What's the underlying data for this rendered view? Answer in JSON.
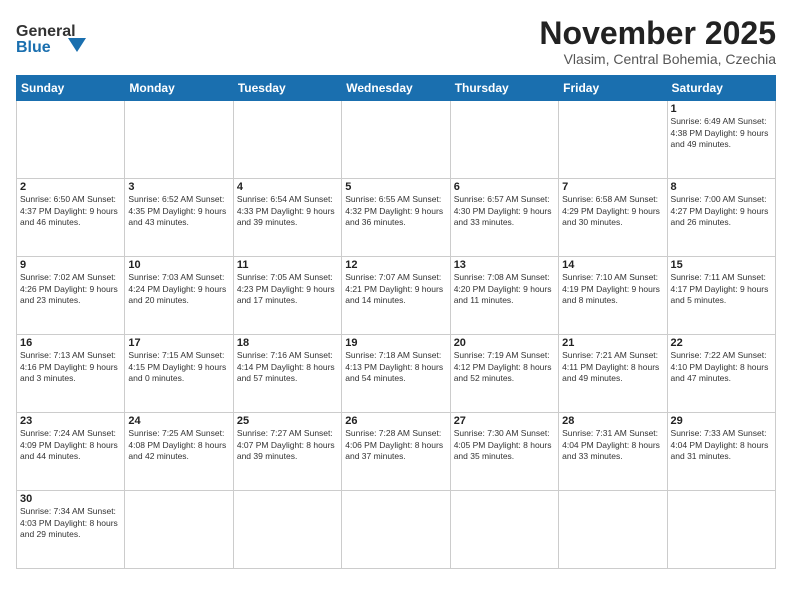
{
  "header": {
    "logo_general": "General",
    "logo_blue": "Blue",
    "month_title": "November 2025",
    "location": "Vlasim, Central Bohemia, Czechia"
  },
  "weekdays": [
    "Sunday",
    "Monday",
    "Tuesday",
    "Wednesday",
    "Thursday",
    "Friday",
    "Saturday"
  ],
  "weeks": [
    [
      {
        "day": "",
        "info": ""
      },
      {
        "day": "",
        "info": ""
      },
      {
        "day": "",
        "info": ""
      },
      {
        "day": "",
        "info": ""
      },
      {
        "day": "",
        "info": ""
      },
      {
        "day": "",
        "info": ""
      },
      {
        "day": "1",
        "info": "Sunrise: 6:49 AM\nSunset: 4:38 PM\nDaylight: 9 hours\nand 49 minutes."
      }
    ],
    [
      {
        "day": "2",
        "info": "Sunrise: 6:50 AM\nSunset: 4:37 PM\nDaylight: 9 hours\nand 46 minutes."
      },
      {
        "day": "3",
        "info": "Sunrise: 6:52 AM\nSunset: 4:35 PM\nDaylight: 9 hours\nand 43 minutes."
      },
      {
        "day": "4",
        "info": "Sunrise: 6:54 AM\nSunset: 4:33 PM\nDaylight: 9 hours\nand 39 minutes."
      },
      {
        "day": "5",
        "info": "Sunrise: 6:55 AM\nSunset: 4:32 PM\nDaylight: 9 hours\nand 36 minutes."
      },
      {
        "day": "6",
        "info": "Sunrise: 6:57 AM\nSunset: 4:30 PM\nDaylight: 9 hours\nand 33 minutes."
      },
      {
        "day": "7",
        "info": "Sunrise: 6:58 AM\nSunset: 4:29 PM\nDaylight: 9 hours\nand 30 minutes."
      },
      {
        "day": "8",
        "info": "Sunrise: 7:00 AM\nSunset: 4:27 PM\nDaylight: 9 hours\nand 26 minutes."
      }
    ],
    [
      {
        "day": "9",
        "info": "Sunrise: 7:02 AM\nSunset: 4:26 PM\nDaylight: 9 hours\nand 23 minutes."
      },
      {
        "day": "10",
        "info": "Sunrise: 7:03 AM\nSunset: 4:24 PM\nDaylight: 9 hours\nand 20 minutes."
      },
      {
        "day": "11",
        "info": "Sunrise: 7:05 AM\nSunset: 4:23 PM\nDaylight: 9 hours\nand 17 minutes."
      },
      {
        "day": "12",
        "info": "Sunrise: 7:07 AM\nSunset: 4:21 PM\nDaylight: 9 hours\nand 14 minutes."
      },
      {
        "day": "13",
        "info": "Sunrise: 7:08 AM\nSunset: 4:20 PM\nDaylight: 9 hours\nand 11 minutes."
      },
      {
        "day": "14",
        "info": "Sunrise: 7:10 AM\nSunset: 4:19 PM\nDaylight: 9 hours\nand 8 minutes."
      },
      {
        "day": "15",
        "info": "Sunrise: 7:11 AM\nSunset: 4:17 PM\nDaylight: 9 hours\nand 5 minutes."
      }
    ],
    [
      {
        "day": "16",
        "info": "Sunrise: 7:13 AM\nSunset: 4:16 PM\nDaylight: 9 hours\nand 3 minutes."
      },
      {
        "day": "17",
        "info": "Sunrise: 7:15 AM\nSunset: 4:15 PM\nDaylight: 9 hours\nand 0 minutes."
      },
      {
        "day": "18",
        "info": "Sunrise: 7:16 AM\nSunset: 4:14 PM\nDaylight: 8 hours\nand 57 minutes."
      },
      {
        "day": "19",
        "info": "Sunrise: 7:18 AM\nSunset: 4:13 PM\nDaylight: 8 hours\nand 54 minutes."
      },
      {
        "day": "20",
        "info": "Sunrise: 7:19 AM\nSunset: 4:12 PM\nDaylight: 8 hours\nand 52 minutes."
      },
      {
        "day": "21",
        "info": "Sunrise: 7:21 AM\nSunset: 4:11 PM\nDaylight: 8 hours\nand 49 minutes."
      },
      {
        "day": "22",
        "info": "Sunrise: 7:22 AM\nSunset: 4:10 PM\nDaylight: 8 hours\nand 47 minutes."
      }
    ],
    [
      {
        "day": "23",
        "info": "Sunrise: 7:24 AM\nSunset: 4:09 PM\nDaylight: 8 hours\nand 44 minutes."
      },
      {
        "day": "24",
        "info": "Sunrise: 7:25 AM\nSunset: 4:08 PM\nDaylight: 8 hours\nand 42 minutes."
      },
      {
        "day": "25",
        "info": "Sunrise: 7:27 AM\nSunset: 4:07 PM\nDaylight: 8 hours\nand 39 minutes."
      },
      {
        "day": "26",
        "info": "Sunrise: 7:28 AM\nSunset: 4:06 PM\nDaylight: 8 hours\nand 37 minutes."
      },
      {
        "day": "27",
        "info": "Sunrise: 7:30 AM\nSunset: 4:05 PM\nDaylight: 8 hours\nand 35 minutes."
      },
      {
        "day": "28",
        "info": "Sunrise: 7:31 AM\nSunset: 4:04 PM\nDaylight: 8 hours\nand 33 minutes."
      },
      {
        "day": "29",
        "info": "Sunrise: 7:33 AM\nSunset: 4:04 PM\nDaylight: 8 hours\nand 31 minutes."
      }
    ],
    [
      {
        "day": "30",
        "info": "Sunrise: 7:34 AM\nSunset: 4:03 PM\nDaylight: 8 hours\nand 29 minutes."
      },
      {
        "day": "",
        "info": ""
      },
      {
        "day": "",
        "info": ""
      },
      {
        "day": "",
        "info": ""
      },
      {
        "day": "",
        "info": ""
      },
      {
        "day": "",
        "info": ""
      },
      {
        "day": "",
        "info": ""
      }
    ]
  ]
}
